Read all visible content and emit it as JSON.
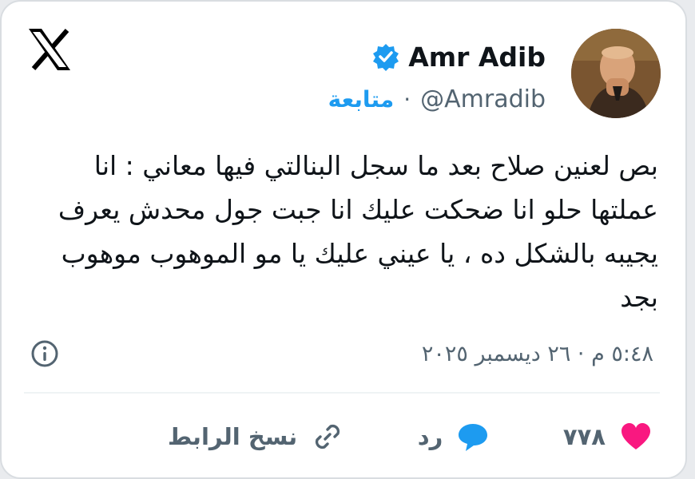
{
  "tweet": {
    "author_name": "Amr Adib",
    "handle": "@Amradib",
    "separator": "·",
    "follow_label": "متابعة",
    "text_lines": [
      "بص لعنين صلاح بعد ما سجل البنالتي فيها معاني : انا",
      "عملتها حلو انا ضحكت عليك انا جبت جول محدش يعرف",
      "يجيبه بالشكل ده ، يا عيني عليك يا مو الموهوب موهوب",
      "بجد"
    ],
    "timestamp": "٥:٤٨ م · ٢٦ ديسمبر ٢٠٢٥"
  },
  "actions": {
    "likes_count": "٧٧٨",
    "reply_label": "رد",
    "copy_link_label": "نسخ الرابط"
  },
  "icons": {
    "logo": "x-logo-icon",
    "verified": "verified-badge-icon",
    "info": "info-icon",
    "like": "heart-icon",
    "reply": "reply-bubble-icon",
    "link": "link-icon"
  },
  "colors": {
    "accent": "#1d9bf0",
    "like": "#f91880",
    "text": "#0f1419",
    "secondary": "#536471"
  }
}
